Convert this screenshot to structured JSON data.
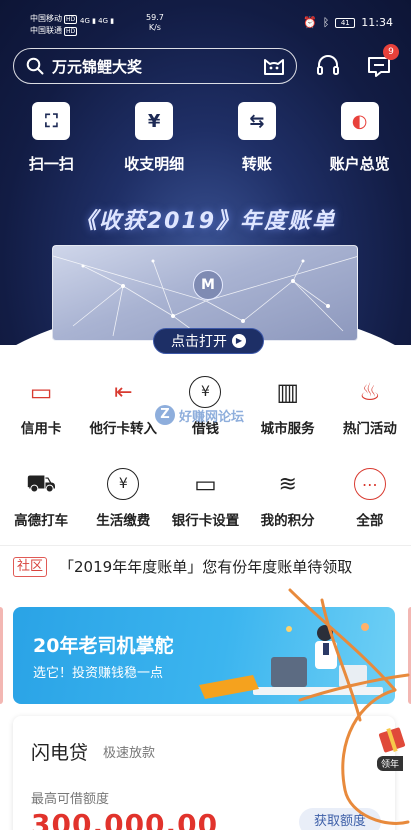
{
  "status_bar": {
    "carrier1": "中国移动",
    "carrier2": "中国联通",
    "hd": "HD",
    "signal": "4G ▮ 4G ▮",
    "net_speed": "59.7",
    "net_unit": "K/s",
    "battery": "41",
    "time": "11:34"
  },
  "search": {
    "text": "万元锦鲤大奖"
  },
  "header": {
    "message_badge": "9"
  },
  "quick_actions": [
    {
      "label": "扫一扫",
      "icon": "scan-icon",
      "glyph": "⛶"
    },
    {
      "label": "收支明细",
      "icon": "yuan-icon",
      "glyph": "¥"
    },
    {
      "label": "转账",
      "icon": "transfer-icon",
      "glyph": "⇆"
    },
    {
      "label": "账户总览",
      "icon": "overview-icon",
      "glyph": "◐"
    }
  ],
  "banner": {
    "title": "《收获2019》年度账单",
    "logo": "M",
    "open_button": "点击打开"
  },
  "services_row1": [
    {
      "label": "信用卡",
      "icon": "credit-card-icon",
      "glyph": "▭"
    },
    {
      "label": "他行卡转入",
      "icon": "card-transfer-icon",
      "glyph": "⇤"
    },
    {
      "label": "借钱",
      "icon": "borrow-icon",
      "glyph": "¥"
    },
    {
      "label": "城市服务",
      "icon": "city-icon",
      "glyph": "▥"
    },
    {
      "label": "热门活动",
      "icon": "fire-icon",
      "glyph": "♨"
    }
  ],
  "services_row2": [
    {
      "label": "高德打车",
      "icon": "car-icon",
      "glyph": "⛟"
    },
    {
      "label": "生活缴费",
      "icon": "payment-icon",
      "glyph": "¥"
    },
    {
      "label": "银行卡设置",
      "icon": "card-settings-icon",
      "glyph": "▭"
    },
    {
      "label": "我的积分",
      "icon": "points-icon",
      "glyph": "≋"
    },
    {
      "label": "全部",
      "icon": "more-icon",
      "glyph": "⋯"
    }
  ],
  "watermark": {
    "letter": "Z",
    "text": "好赚网论坛"
  },
  "community": {
    "tag": "社区",
    "message": "「2019年年度账单」您有份年度账单待领取"
  },
  "promo": {
    "title": "20年老司机掌舵",
    "subtitle": "选它！投资赚钱稳一点"
  },
  "loan": {
    "title": "闪电贷",
    "subtitle": "极速放款",
    "limit_label": "最高可借额度",
    "amount": "300,000.00",
    "button": "获取额度"
  },
  "float_ad": {
    "label": "领年"
  },
  "colors": {
    "hero_dark": "#121c44",
    "accent_red": "#d83a30",
    "amount_red": "#e1332c",
    "promo_blue": "#2aa3e6",
    "scribble": "#e88a3c"
  }
}
